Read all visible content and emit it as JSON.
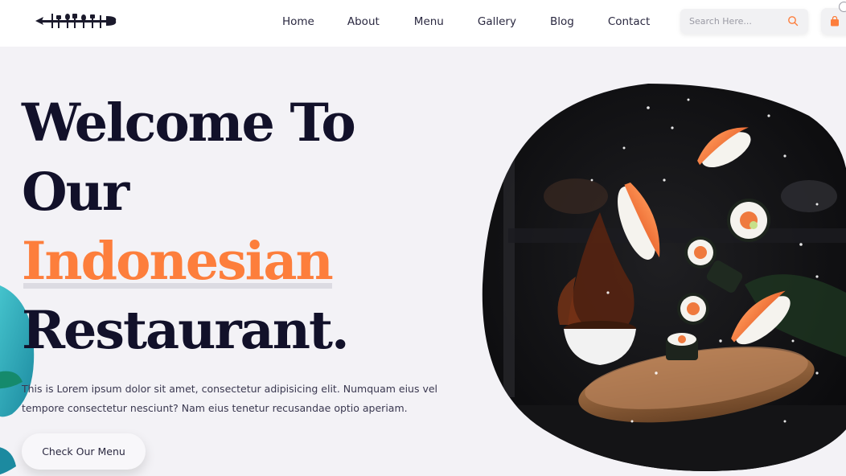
{
  "nav": {
    "logo_name": "cutlery-logo",
    "links": [
      "Home",
      "About",
      "Menu",
      "Gallery",
      "Blog",
      "Contact"
    ]
  },
  "search": {
    "placeholder": "Search Here...",
    "icon": "search-icon"
  },
  "cart": {
    "icon": "shopping-bag-icon"
  },
  "hero": {
    "title_line1": "Welcome To",
    "title_line2": "Our",
    "title_accent": "Indonesian",
    "title_line4": "Restaurant.",
    "description": "This is Lorem ipsum dolor sit amet, consectetur adipisicing elit. Numquam eius vel tempore consectetur nesciunt? Nam eius tenetur recusandae optio aperiam.",
    "cta_label": "Check Our Menu"
  },
  "colors": {
    "accent": "#fd7e3c",
    "dark": "#12112a",
    "background": "#f3f2f6"
  }
}
